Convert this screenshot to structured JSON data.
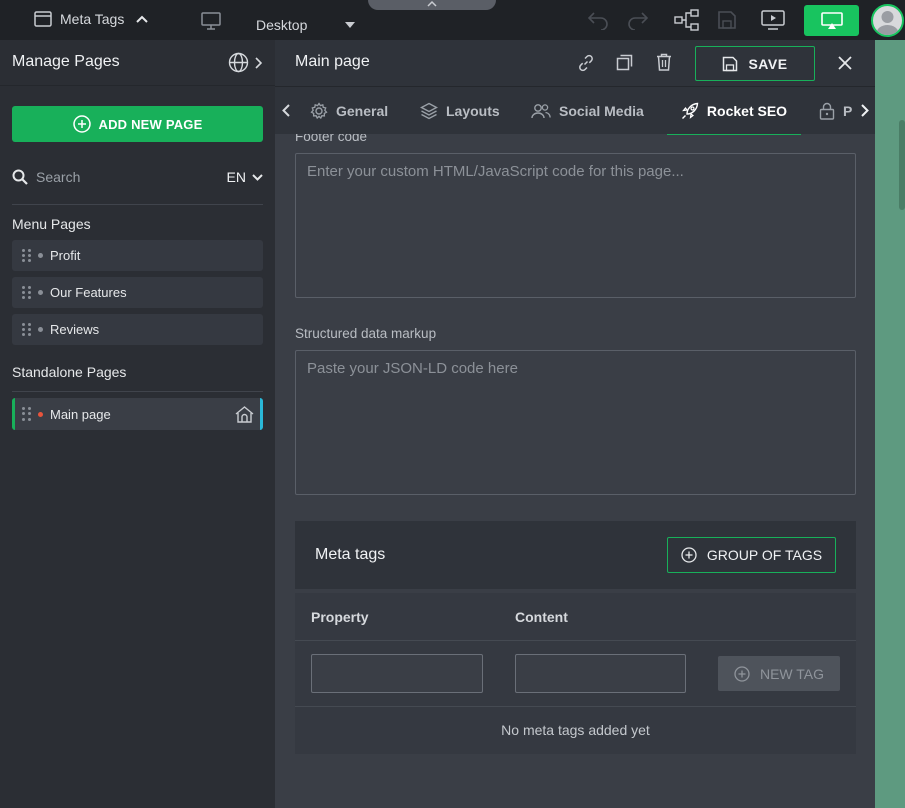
{
  "topbar": {
    "panel_label": "Meta Tags",
    "device_label": "Desktop"
  },
  "sidebar": {
    "title": "Manage Pages",
    "add_page_label": "ADD NEW PAGE",
    "search_placeholder": "Search",
    "language": "EN",
    "menu_section": "Menu Pages",
    "menu_pages": [
      {
        "label": "Profit"
      },
      {
        "label": "Our Features"
      },
      {
        "label": "Reviews"
      }
    ],
    "standalone_section": "Standalone Pages",
    "standalone_pages": [
      {
        "label": "Main page"
      }
    ]
  },
  "panel": {
    "title": "Main page",
    "save_label": "SAVE",
    "tabs": [
      {
        "label": "General",
        "icon": "gear-icon"
      },
      {
        "label": "Layouts",
        "icon": "layers-icon"
      },
      {
        "label": "Social Media",
        "icon": "users-icon"
      },
      {
        "label": "Rocket SEO",
        "icon": "rocket-icon"
      },
      {
        "label": "P",
        "icon": "lock-icon"
      }
    ],
    "footer_code_label": "Footer code",
    "footer_code_placeholder": "Enter your custom HTML/JavaScript code for this page...",
    "structured_label": "Structured data markup",
    "structured_placeholder": "Paste your JSON-LD code here",
    "meta": {
      "title": "Meta tags",
      "group_button": "GROUP OF TAGS",
      "col_property": "Property",
      "col_content": "Content",
      "new_tag": "NEW TAG",
      "empty_text": "No meta tags added yet"
    }
  },
  "colors": {
    "accent": "#18b05a",
    "sidebar_bg": "#2b2e34",
    "panel_bg": "#3a3e46"
  }
}
